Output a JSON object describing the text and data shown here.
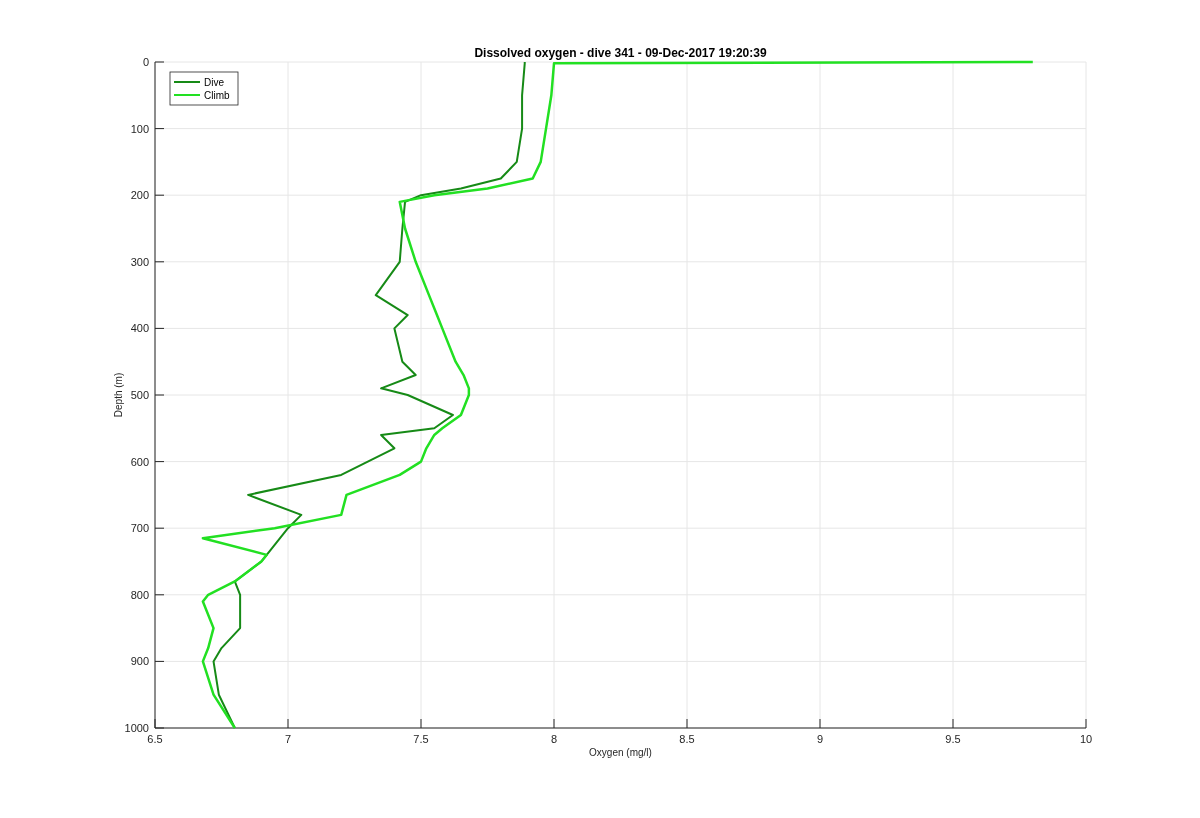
{
  "figure": {
    "chart_data": {
      "type": "line",
      "orientation": "horizontal",
      "title": "Dissolved oxygen - dive 341 - 09-Dec-2017 19:20:39",
      "xlabel": "Oxygen (mg/l)",
      "ylabel": "Depth (m)",
      "xlim": [
        6.5,
        10
      ],
      "ylim": [
        1000,
        0
      ],
      "xticks": [
        {
          "value": 6.5,
          "label": "6.5"
        },
        {
          "value": 7,
          "label": "7"
        },
        {
          "value": 7.5,
          "label": "7.5"
        },
        {
          "value": 8,
          "label": "8"
        },
        {
          "value": 8.5,
          "label": "8.5"
        },
        {
          "value": 9,
          "label": "9"
        },
        {
          "value": 9.5,
          "label": "9.5"
        },
        {
          "value": 10,
          "label": "10"
        }
      ],
      "yticks": [
        0,
        100,
        200,
        300,
        400,
        500,
        600,
        700,
        800,
        900,
        1000
      ],
      "grid": true,
      "legend": true,
      "x": [
        0,
        2,
        50,
        100,
        150,
        175,
        190,
        200,
        210,
        250,
        300,
        350,
        380,
        400,
        450,
        470,
        490,
        500,
        530,
        550,
        560,
        580,
        600,
        620,
        650,
        680,
        700,
        715,
        740,
        750,
        780,
        800,
        810,
        850,
        880,
        900,
        950,
        1000
      ],
      "series": [
        {
          "name": "Dive",
          "color": "#168a16",
          "values": [
            7.89,
            7.89,
            7.88,
            7.88,
            7.86,
            7.8,
            7.65,
            7.5,
            7.44,
            7.43,
            7.42,
            7.33,
            7.45,
            7.4,
            7.43,
            7.48,
            7.35,
            7.45,
            7.62,
            7.55,
            7.35,
            7.4,
            7.3,
            7.2,
            6.85,
            7.05,
            7.0,
            6.97,
            6.92,
            6.9,
            6.8,
            6.82,
            6.82,
            6.82,
            6.75,
            6.72,
            6.74,
            6.8
          ]
        },
        {
          "name": "Climb",
          "color": "#22e022",
          "values": [
            9.8,
            8.0,
            7.99,
            7.97,
            7.95,
            7.92,
            7.75,
            7.55,
            7.42,
            7.44,
            7.48,
            7.53,
            7.56,
            7.58,
            7.63,
            7.66,
            7.68,
            7.68,
            7.65,
            7.58,
            7.55,
            7.52,
            7.5,
            7.42,
            7.22,
            7.2,
            6.95,
            6.68,
            6.92,
            6.9,
            6.8,
            6.7,
            6.68,
            6.72,
            6.7,
            6.68,
            6.72,
            6.8
          ]
        }
      ]
    }
  }
}
